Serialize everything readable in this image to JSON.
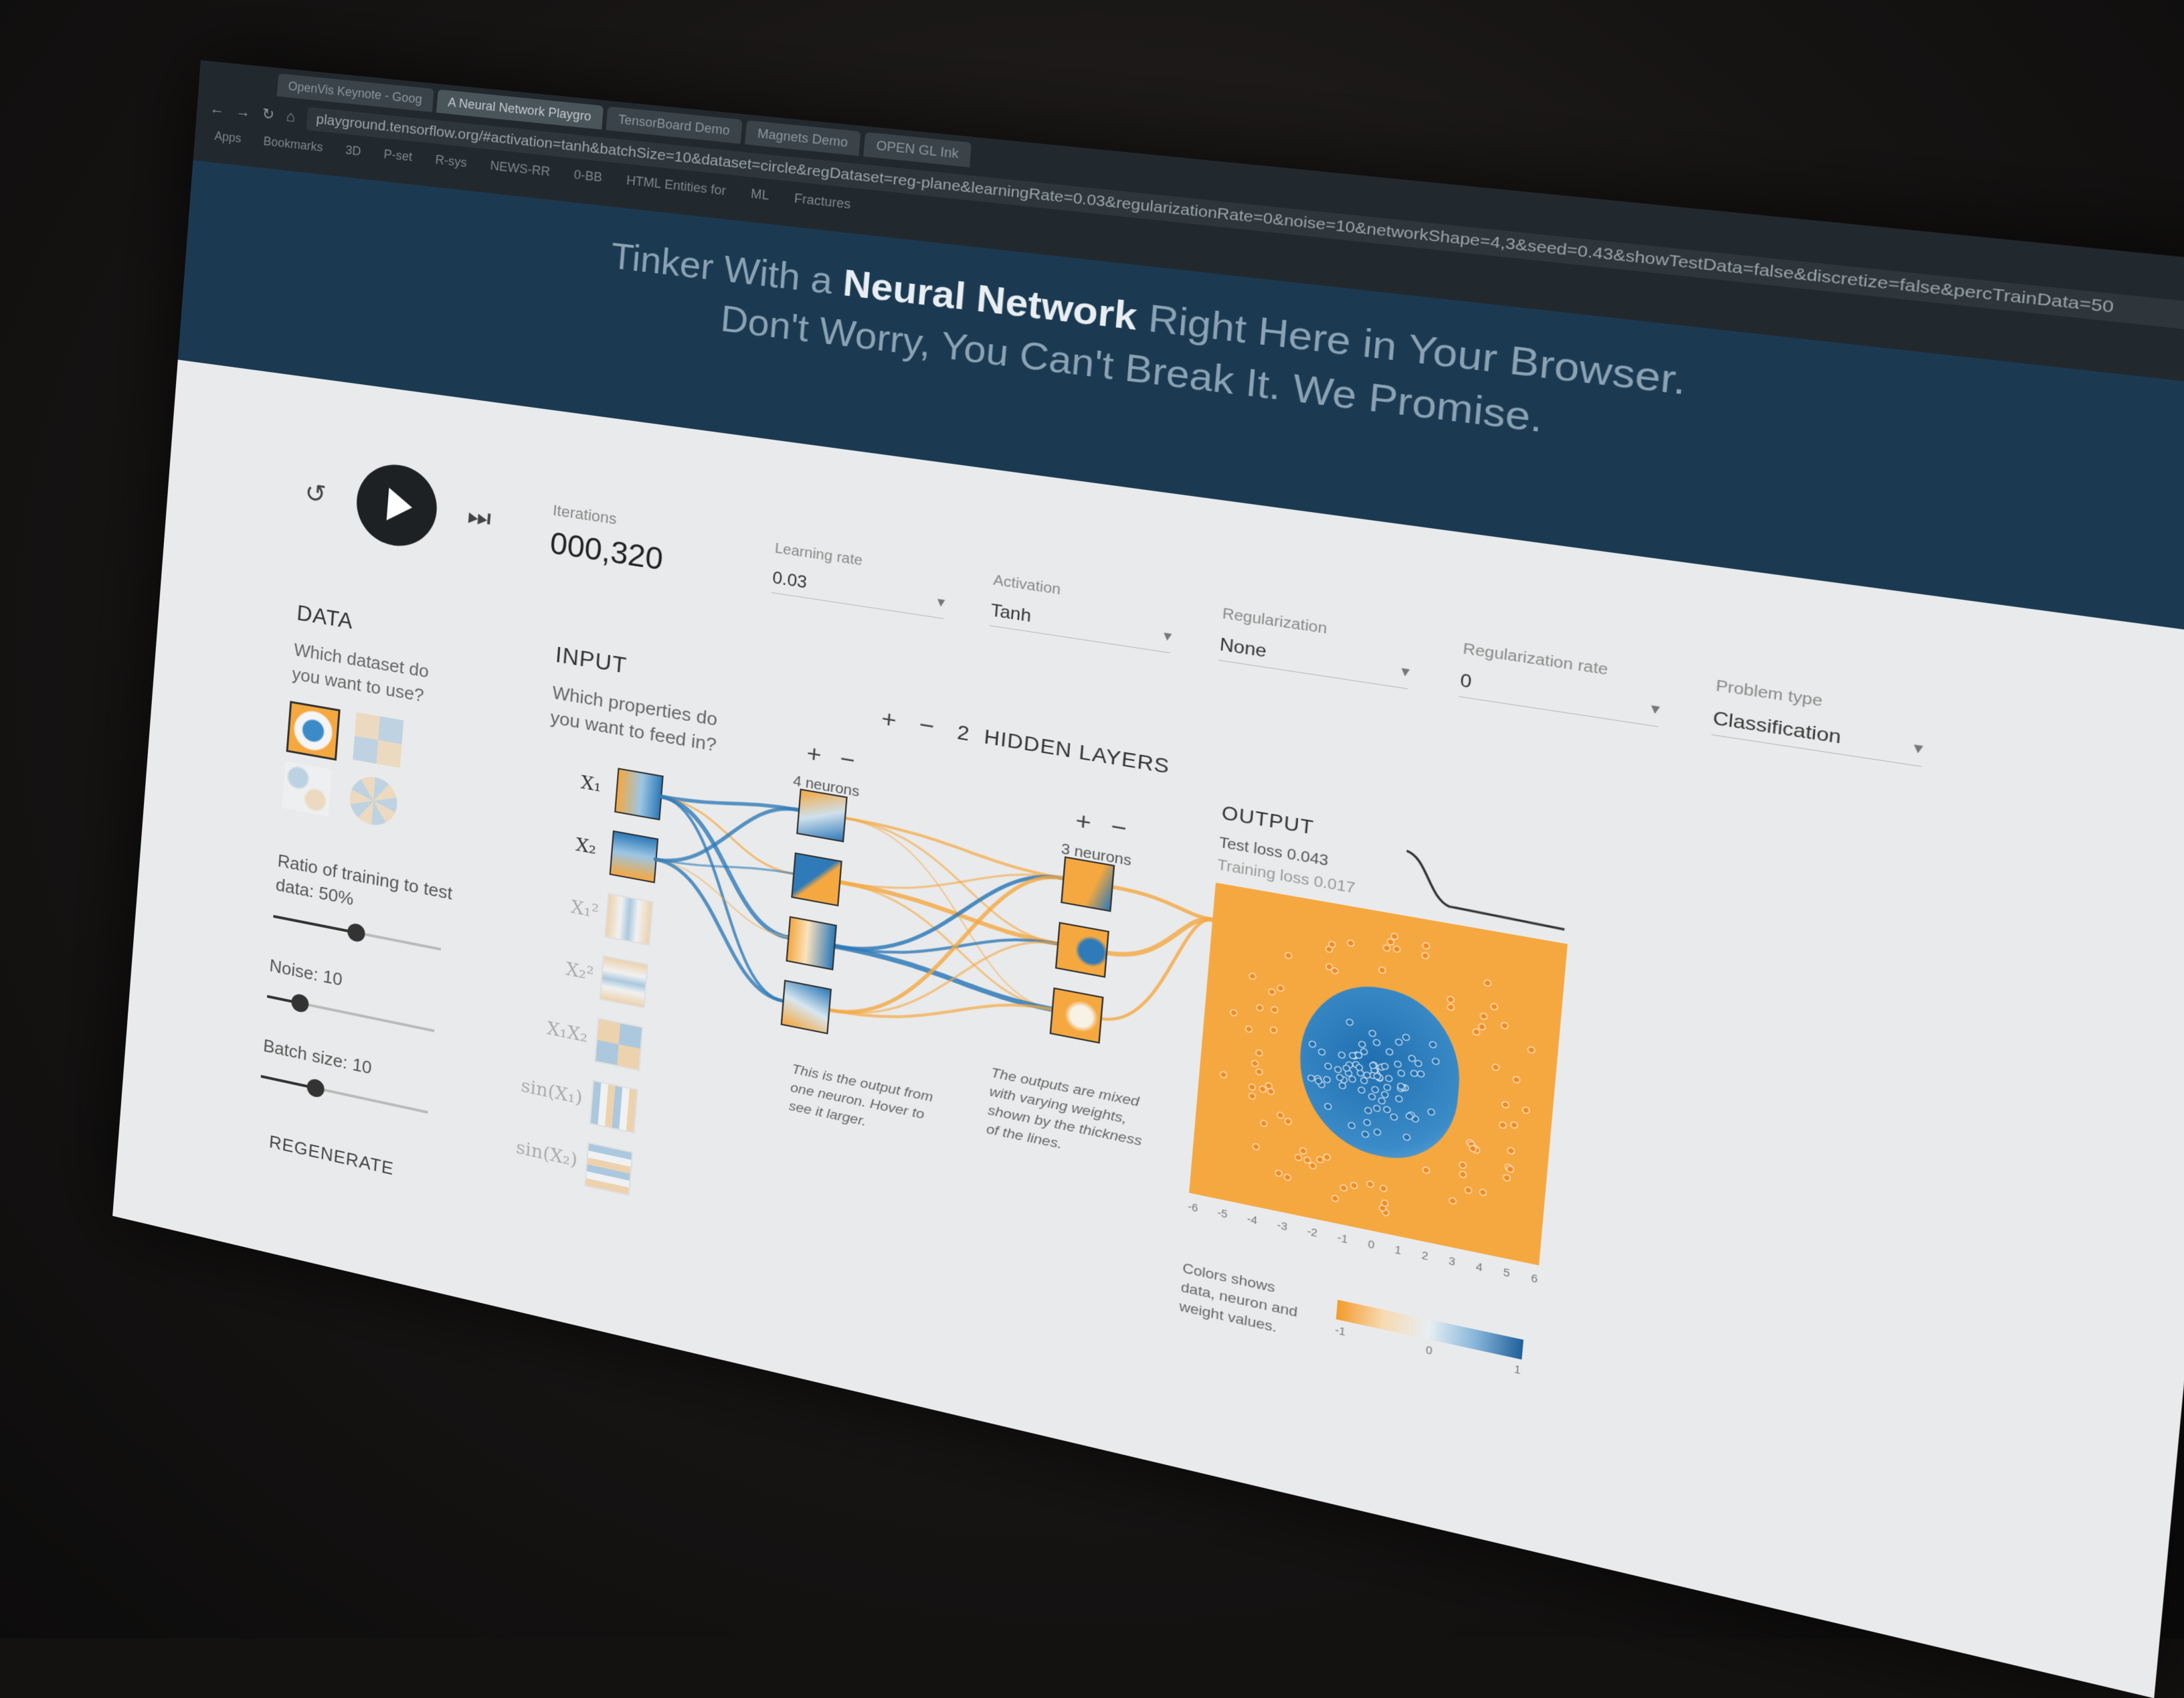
{
  "browser": {
    "tabs": [
      "OpenVis Keynote - Goog",
      "A Neural Network Playgro",
      "TensorBoard Demo",
      "Magnets Demo",
      "OPEN GL Ink"
    ],
    "url": "playground.tensorflow.org/#activation=tanh&batchSize=10&dataset=circle&regDataset=reg-plane&learningRate=0.03&regularizationRate=0&noise=10&networkShape=4,3&seed=0.43&showTestData=false&discretize=false&percTrainData=50",
    "apps_label": "Apps",
    "bookmarks": [
      "Bookmarks",
      "3D",
      "P-set",
      "R-sys",
      "NEWS-RR",
      "0-BB",
      "HTML Entities for",
      "ML",
      "Fractures"
    ]
  },
  "header": {
    "line1_prefix": "Tinker With a ",
    "line1_bold": "Neural Network",
    "line1_suffix": " Right Here in Your Browser.",
    "line2": "Don't Worry, You Can't Break It. We Promise."
  },
  "controls": {
    "iterations_label": "Iterations",
    "iterations_value": "000,320",
    "learning_rate_label": "Learning rate",
    "learning_rate_value": "0.03",
    "activation_label": "Activation",
    "activation_value": "Tanh",
    "regularization_label": "Regularization",
    "regularization_value": "None",
    "reg_rate_label": "Regularization rate",
    "reg_rate_value": "0",
    "problem_type_label": "Problem type",
    "problem_type_value": "Classification"
  },
  "data_panel": {
    "title": "DATA",
    "question": "Which dataset do you want to use?",
    "ratio_label": "Ratio of training to test data:",
    "ratio_value": "50%",
    "ratio_fraction": 0.5,
    "noise_label": "Noise:",
    "noise_value": "10",
    "noise_fraction": 0.2,
    "batch_label": "Batch size:",
    "batch_value": "10",
    "batch_fraction": 0.33,
    "regenerate_label": "REGENERATE"
  },
  "input_panel": {
    "title": "INPUT",
    "question": "Which properties do you want to feed in?",
    "features": [
      "X₁",
      "X₂",
      "X₁²",
      "X₂²",
      "X₁X₂",
      "sin(X₁)",
      "sin(X₂)"
    ]
  },
  "network": {
    "plus": "+",
    "minus": "−",
    "hidden_count": "2",
    "hidden_label": "HIDDEN LAYERS",
    "layer1_label": "4 neurons",
    "layer2_label": "3 neurons",
    "note_neuron": "This is the output from one neuron. Hover to see it larger.",
    "note_weights": "The outputs are mixed with varying weights, shown by the thickness of the lines."
  },
  "output_panel": {
    "title": "OUTPUT",
    "test_loss": "Test loss 0.043",
    "training_loss": "Training loss 0.017",
    "legend_text": "Colors shows data, neuron and weight values.",
    "legend_ticks": [
      "-1",
      "0",
      "1"
    ],
    "axis_ticks": [
      "-6",
      "-5",
      "-4",
      "-3",
      "-2",
      "-1",
      "0",
      "1",
      "2",
      "3",
      "4",
      "5",
      "6"
    ]
  },
  "colors": {
    "orange": "#f5a840",
    "blue": "#1f6fb0",
    "header_bg": "#1b3a52",
    "page_bg": "#e9eaeb"
  },
  "icons": [
    "reset-icon",
    "play-icon",
    "step-icon",
    "cursor-icon"
  ]
}
